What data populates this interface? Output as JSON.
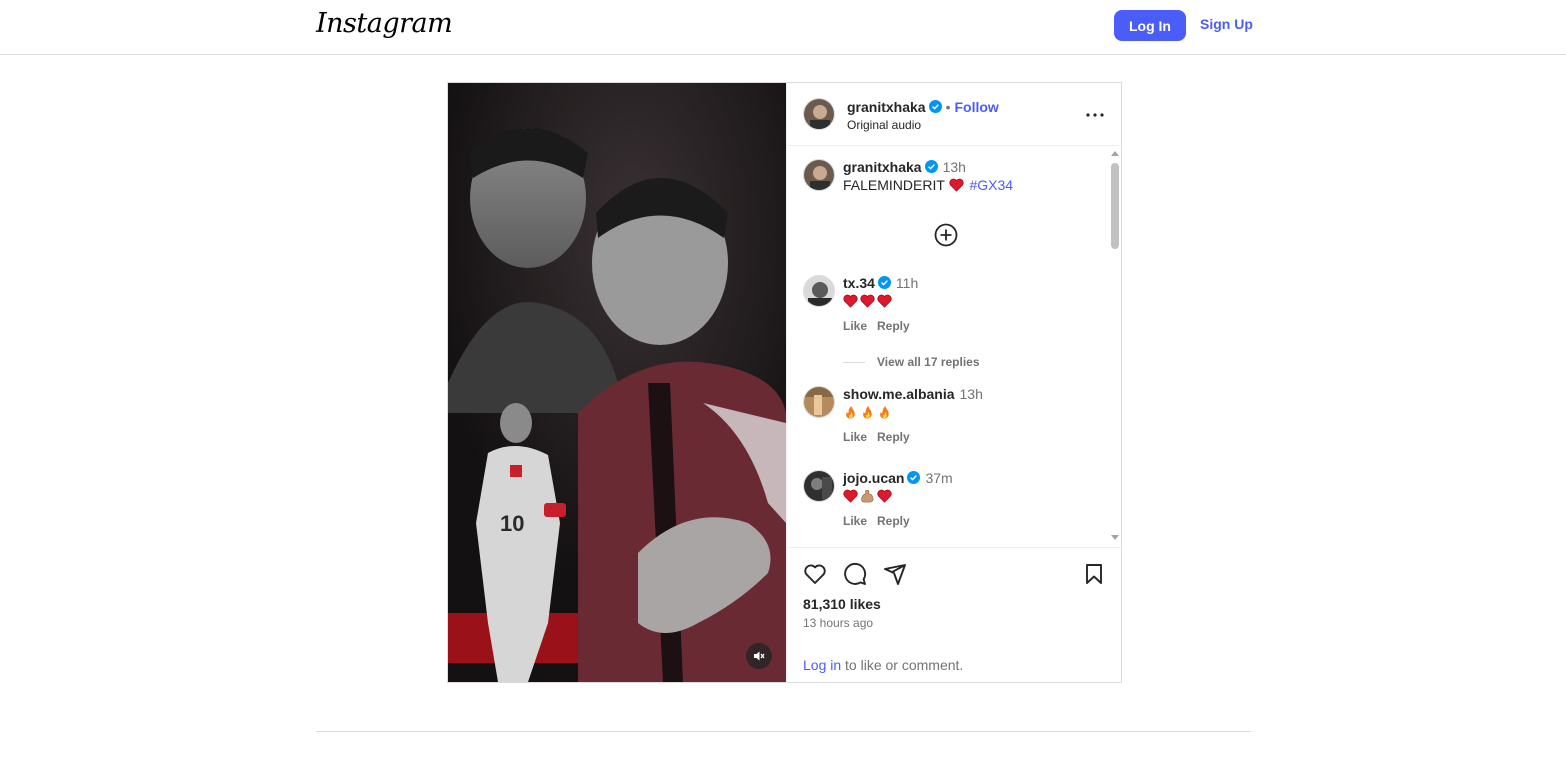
{
  "header": {
    "logo": "Instagram",
    "login_label": "Log In",
    "signup_label": "Sign Up"
  },
  "post": {
    "author": "granitxhaka",
    "follow_label": "Follow",
    "separator": "•",
    "subtitle": "Original audio",
    "caption": {
      "user": "granitxhaka",
      "time": "13h",
      "text": "FALEMINDERIT",
      "hashtag": "#GX34"
    },
    "comments": [
      {
        "user": "tx.34",
        "time": "11h",
        "text_emoji": [
          "heart",
          "heart",
          "heart"
        ],
        "like_label": "Like",
        "reply_label": "Reply",
        "verified": true
      },
      {
        "user": "show.me.albania",
        "time": "13h",
        "text_emoji": [
          "fire",
          "fire",
          "fire"
        ],
        "like_label": "Like",
        "reply_label": "Reply",
        "verified": false
      },
      {
        "user": "jojo.ucan",
        "time": "37m",
        "text_emoji": [
          "heart",
          "flexed-biceps",
          "heart"
        ],
        "like_label": "Like",
        "reply_label": "Reply",
        "verified": true
      }
    ],
    "view_replies_label": "View all 17 replies",
    "likes": "81,310 likes",
    "posted_ago": "13 hours ago",
    "login_prompt": {
      "link": "Log in",
      "rest": " to like or comment."
    }
  },
  "colors": {
    "accent": "#4a5df9",
    "verified": "#0095f6",
    "muted": "#737373",
    "border": "#dbdbdb"
  },
  "icons": [
    "verified-badge-icon",
    "more-options-icon",
    "plus-circle-icon",
    "heart-icon",
    "comment-icon",
    "share-icon",
    "bookmark-icon",
    "mute-icon"
  ]
}
